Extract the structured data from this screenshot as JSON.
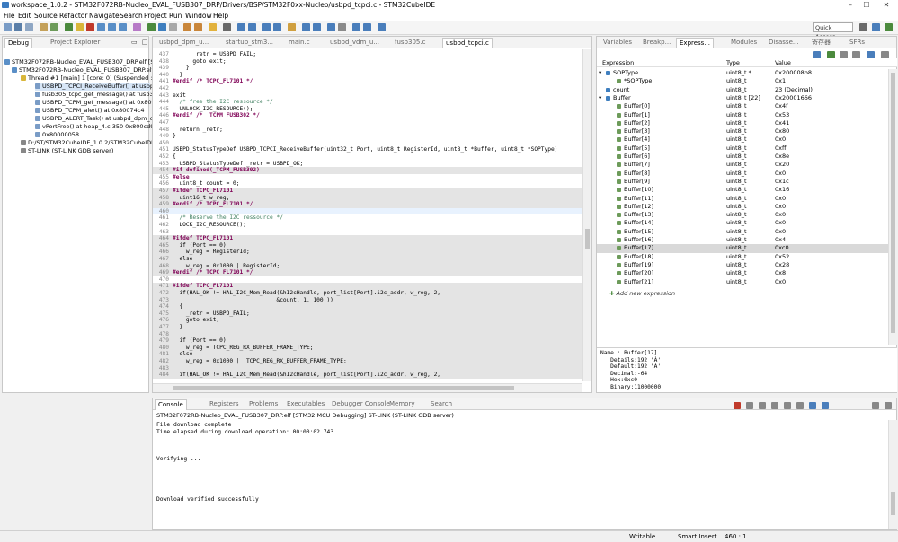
{
  "window": {
    "title": "workspace_1.0.2 - STM32F072RB-Nucleo_EVAL_FUSB307_DRP/Drivers/BSP/STM32F0xx-Nucleo/usbpd_tcpci.c - STM32CubeIDE",
    "min": "–",
    "max": "☐",
    "close": "✕"
  },
  "menu": [
    "File",
    "Edit",
    "Source",
    "Refactor",
    "Navigate",
    "Search",
    "Project",
    "Run",
    "Window",
    "Help"
  ],
  "quick_access": "Quick Access",
  "debug": {
    "tabs": [
      "Debug",
      "Project Explorer"
    ],
    "items": [
      "STM32F072RB-Nucleo_EVAL_FUSB307_DRP.elf [S",
      "STM32F072RB-Nucleo_EVAL_FUSB307_DRP.elf",
      "Thread #1 [main] 1 [core: 0] (Suspended : Br",
      "USBPD_TCPCI_ReceiveBuffer() at usbpd_t",
      "fusb305_tcpc_get_message() at fusb305.c",
      "USBPD_TCPM_get_message() at 0x80077",
      "USBPD_TCPM_alert() at 0x80074c4",
      "USBPD_ALERT_Task() at usbpd_dpm_core",
      "vPortFree() at heap_4.c:350 0x800cd90",
      "0x80000058",
      "D:/ST/STM32CubeIDE_1.0.2/STM32CubeIDE/p",
      "ST-LINK (ST-LINK GDB server)"
    ]
  },
  "editor": {
    "tabs": [
      "usbpd_dpm_u...",
      "startup_stm3...",
      "main.c",
      "usbpd_vdm_u...",
      "fusb305.c",
      "usbpd_tcpci.c"
    ],
    "lines": [
      {
        "n": "437",
        "t": "      _retr = USBPD_FAIL;",
        "k": ""
      },
      {
        "n": "438",
        "t": "      goto exit;",
        "k": ""
      },
      {
        "n": "439",
        "t": "    }",
        "k": ""
      },
      {
        "n": "440",
        "t": "  }",
        "k": ""
      },
      {
        "n": "441",
        "t": "#endif /* TCPC_FL7101 */",
        "k": ""
      },
      {
        "n": "442",
        "t": "",
        "k": ""
      },
      {
        "n": "443",
        "t": "exit :",
        "k": ""
      },
      {
        "n": "444",
        "t": "  /* free the I2C ressource */",
        "k": ""
      },
      {
        "n": "445",
        "t": "  UNLOCK_I2C_RESOURCE();",
        "k": ""
      },
      {
        "n": "446",
        "t": "#endif /* _TCPM_FUSB302 */",
        "k": ""
      },
      {
        "n": "447",
        "t": "",
        "k": ""
      },
      {
        "n": "448",
        "t": "  return _retr;",
        "k": ""
      },
      {
        "n": "449",
        "t": "}",
        "k": ""
      },
      {
        "n": "450",
        "t": "",
        "k": ""
      },
      {
        "n": "451",
        "t": "USBPD_StatusTypeDef USBPD_TCPCI_ReceiveBuffer(uint32_t Port, uint8_t RegisterId, uint8_t *Buffer, uint8_t *SOPType)",
        "k": ""
      },
      {
        "n": "452",
        "t": "{",
        "k": ""
      },
      {
        "n": "453",
        "t": "  USBPD_StatusTypeDef _retr = USBPD_OK;",
        "k": ""
      },
      {
        "n": "454",
        "t": "#if defined(_TCPM_FUSB302)",
        "k": "inactive"
      },
      {
        "n": "455",
        "t": "#else",
        "k": ""
      },
      {
        "n": "456",
        "t": "  uint8_t count = 0;",
        "k": ""
      },
      {
        "n": "457",
        "t": "#ifdef TCPC_FL7101",
        "k": "inactive"
      },
      {
        "n": "458",
        "t": "  uint16_t w_reg;",
        "k": "inactive"
      },
      {
        "n": "459",
        "t": "#endif /* TCPC_FL7101 */",
        "k": "inactive"
      },
      {
        "n": "460",
        "t": "",
        "k": ""
      },
      {
        "n": "461",
        "t": "  /* Reserve the I2C ressource */",
        "k": ""
      },
      {
        "n": "462",
        "t": "  LOCK_I2C_RESOURCE();",
        "k": ""
      },
      {
        "n": "463",
        "t": "",
        "k": ""
      },
      {
        "n": "464",
        "t": "#ifdef TCPC_FL7101",
        "k": "inactive"
      },
      {
        "n": "465",
        "t": "  if (Port == 0)",
        "k": "inactive"
      },
      {
        "n": "466",
        "t": "    w_reg = RegisterId;",
        "k": "inactive"
      },
      {
        "n": "467",
        "t": "  else",
        "k": "inactive"
      },
      {
        "n": "468",
        "t": "    w_reg = 0x1000 | RegisterId;",
        "k": "inactive"
      },
      {
        "n": "469",
        "t": "#endif /* TCPC_FL7101 */",
        "k": "inactive"
      },
      {
        "n": "470",
        "t": "",
        "k": ""
      },
      {
        "n": "471",
        "t": "#ifdef TCPC_FL7101",
        "k": "inactive"
      },
      {
        "n": "472",
        "t": "  if(HAL_OK != HAL_I2C_Mem_Read(&hI2cHandle, port_list[Port].i2c_addr, w_reg, 2,",
        "k": "inactive"
      },
      {
        "n": "473",
        "t": "                               &count, 1, 100 ))",
        "k": "inactive"
      },
      {
        "n": "474",
        "t": "  {",
        "k": "inactive"
      },
      {
        "n": "475",
        "t": "    _retr = USBPD_FAIL;",
        "k": "inactive"
      },
      {
        "n": "476",
        "t": "    goto exit;",
        "k": "inactive"
      },
      {
        "n": "477",
        "t": "  }",
        "k": "inactive"
      },
      {
        "n": "478",
        "t": "",
        "k": "inactive"
      },
      {
        "n": "479",
        "t": "  if (Port == 0)",
        "k": "inactive"
      },
      {
        "n": "480",
        "t": "    w_reg = TCPC_REG_RX_BUFFER_FRAME_TYPE;",
        "k": "inactive"
      },
      {
        "n": "481",
        "t": "  else",
        "k": "inactive"
      },
      {
        "n": "482",
        "t": "    w_reg = 0x1000 |  TCPC_REG_RX_BUFFER_FRAME_TYPE;",
        "k": "inactive"
      },
      {
        "n": "483",
        "t": "",
        "k": "inactive"
      },
      {
        "n": "484",
        "t": "  if(HAL_OK != HAL_I2C_Mem_Read(&hI2cHandle, port_list[Port].i2c_addr, w_reg, 2,",
        "k": "inactive"
      }
    ]
  },
  "expressions": {
    "tabs": [
      "Variables",
      "Breakp...",
      "Express...",
      "Modules",
      "Disasse...",
      "寄存器",
      "SFRs"
    ],
    "columns": [
      "Expression",
      "Type",
      "Value"
    ],
    "rows": [
      {
        "e": "SOPType",
        "t": "uint8_t *",
        "v": "0x200008b8",
        "d": 1,
        "ex": "open"
      },
      {
        "e": "*SOPType",
        "t": "uint8_t",
        "v": "0x1",
        "d": 2,
        "ex": ""
      },
      {
        "e": "count",
        "t": "uint8_t",
        "v": "23 (Decimal)",
        "d": 1,
        "ex": ""
      },
      {
        "e": "Buffer",
        "t": "uint8_t [22]",
        "v": "0x20001666",
        "d": 1,
        "ex": "open"
      },
      {
        "e": "Buffer[0]",
        "t": "uint8_t",
        "v": "0x4f",
        "d": 2,
        "ex": ""
      },
      {
        "e": "Buffer[1]",
        "t": "uint8_t",
        "v": "0x53",
        "d": 2,
        "ex": ""
      },
      {
        "e": "Buffer[2]",
        "t": "uint8_t",
        "v": "0x41",
        "d": 2,
        "ex": ""
      },
      {
        "e": "Buffer[3]",
        "t": "uint8_t",
        "v": "0x80",
        "d": 2,
        "ex": ""
      },
      {
        "e": "Buffer[4]",
        "t": "uint8_t",
        "v": "0x0",
        "d": 2,
        "ex": ""
      },
      {
        "e": "Buffer[5]",
        "t": "uint8_t",
        "v": "0xff",
        "d": 2,
        "ex": ""
      },
      {
        "e": "Buffer[6]",
        "t": "uint8_t",
        "v": "0x8e",
        "d": 2,
        "ex": ""
      },
      {
        "e": "Buffer[7]",
        "t": "uint8_t",
        "v": "0x20",
        "d": 2,
        "ex": ""
      },
      {
        "e": "Buffer[8]",
        "t": "uint8_t",
        "v": "0x0",
        "d": 2,
        "ex": ""
      },
      {
        "e": "Buffer[9]",
        "t": "uint8_t",
        "v": "0x1c",
        "d": 2,
        "ex": ""
      },
      {
        "e": "Buffer[10]",
        "t": "uint8_t",
        "v": "0x16",
        "d": 2,
        "ex": ""
      },
      {
        "e": "Buffer[11]",
        "t": "uint8_t",
        "v": "0x0",
        "d": 2,
        "ex": ""
      },
      {
        "e": "Buffer[12]",
        "t": "uint8_t",
        "v": "0x0",
        "d": 2,
        "ex": ""
      },
      {
        "e": "Buffer[13]",
        "t": "uint8_t",
        "v": "0x0",
        "d": 2,
        "ex": ""
      },
      {
        "e": "Buffer[14]",
        "t": "uint8_t",
        "v": "0x0",
        "d": 2,
        "ex": ""
      },
      {
        "e": "Buffer[15]",
        "t": "uint8_t",
        "v": "0x0",
        "d": 2,
        "ex": ""
      },
      {
        "e": "Buffer[16]",
        "t": "uint8_t",
        "v": "0x4",
        "d": 2,
        "ex": ""
      },
      {
        "e": "Buffer[17]",
        "t": "uint8_t",
        "v": "0xc0",
        "d": 2,
        "ex": "sel"
      },
      {
        "e": "Buffer[18]",
        "t": "uint8_t",
        "v": "0x52",
        "d": 2,
        "ex": ""
      },
      {
        "e": "Buffer[19]",
        "t": "uint8_t",
        "v": "0x28",
        "d": 2,
        "ex": ""
      },
      {
        "e": "Buffer[20]",
        "t": "uint8_t",
        "v": "0x8",
        "d": 2,
        "ex": ""
      },
      {
        "e": "Buffer[21]",
        "t": "uint8_t",
        "v": "0x0",
        "d": 2,
        "ex": ""
      }
    ],
    "add_new": "Add new expression",
    "detail": "Name : Buffer[17]\n   Details:192 'À'\n   Default:192 'À'\n   Decimal:-64\n   Hex:0xc0\n   Binary:11000000"
  },
  "console": {
    "tabs": [
      "Console",
      "Registers",
      "Problems",
      "Executables",
      "Debugger Console",
      "Memory",
      "Search"
    ],
    "header": "STM32F072RB-Nucleo_EVAL_FUSB307_DRP.elf [STM32 MCU Debugging] ST-LINK (ST-LINK GDB server)",
    "text": "File download complete\nTime elapsed during download operation: 00:00:02.743\n\n\n\nVerifying ...\n\n\n\n\n\nDownload verified successfully"
  },
  "status": {
    "mode": "Writable",
    "insert": "Smart Insert",
    "pos": "460 : 1"
  }
}
